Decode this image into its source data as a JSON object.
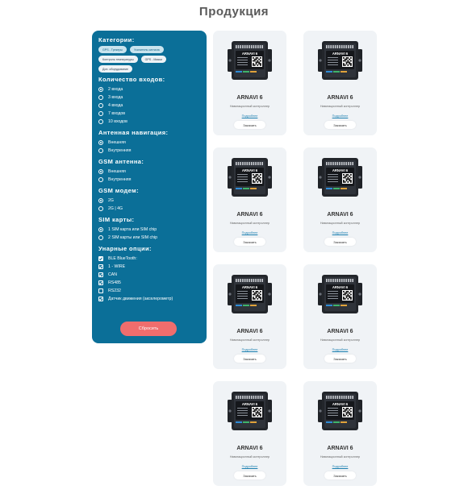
{
  "page": {
    "title": "Продукция"
  },
  "filters": {
    "categories_title": "Категории:",
    "categories": [
      {
        "label": "GPS - Трекеры",
        "active": true
      },
      {
        "label": "Усилитель сигнала",
        "active": false
      },
      {
        "label": "Контроль температуры",
        "active": false
      },
      {
        "label": "GPS - Маяки",
        "active": false
      },
      {
        "label": "Доп. оборудование",
        "active": false
      }
    ],
    "inputs_title": "Количество входов:",
    "inputs": [
      "2 входа",
      "3 входа",
      "4 входа",
      "7 входов",
      "10 входов"
    ],
    "antenna_title": "Антенная навигация:",
    "antenna": [
      "Внешняя",
      "Внутренняя"
    ],
    "gsm_antenna_title": "GSM антенна:",
    "gsm_antenna": [
      "Внешняя",
      "Внутренняя"
    ],
    "gsm_modem_title": "GSM модем:",
    "gsm_modem": [
      "2G",
      "2G | 4G"
    ],
    "sim_title": "SIM карты:",
    "sim": [
      "1 SIM карта или SIM chip",
      "2 SIM карты или SIM chip"
    ],
    "options_title": "Унарные опции:",
    "options": [
      "BLE BlueTooth:",
      "1 - WIRE",
      "CAN",
      "RS485",
      "RS232",
      "Датчик движения (акселерометр)"
    ],
    "reset_label": "Сбросить"
  },
  "products": [
    {
      "name": "ARNAVI 6",
      "subtitle": "Навигационный контроллер",
      "link": "Подробнее",
      "button": "Заказать"
    },
    {
      "name": "ARNAVI 6",
      "subtitle": "Навигационный контроллер",
      "link": "Подробнее",
      "button": "Заказать"
    },
    {
      "name": "ARNAVI 6",
      "subtitle": "Навигационный контроллер",
      "link": "Подробнее",
      "button": "Заказать"
    },
    {
      "name": "ARNAVI 6",
      "subtitle": "Навигационный контроллер",
      "link": "Подробнее",
      "button": "Заказать"
    },
    {
      "name": "ARNAVI 6",
      "subtitle": "Навигационный контроллер",
      "link": "Подробнее",
      "button": "Заказать"
    },
    {
      "name": "ARNAVI 6",
      "subtitle": "Навигационный контроллер",
      "link": "Подробнее",
      "button": "Заказать"
    },
    {
      "name": "ARNAVI 6",
      "subtitle": "Навигационный контроллер",
      "link": "Подробнее",
      "button": "Заказать"
    },
    {
      "name": "ARNAVI 6",
      "subtitle": "Навигационный контроллер",
      "link": "Подробнее",
      "button": "Заказать"
    }
  ],
  "device_label": "ARNAVI 6",
  "colors": {
    "sidebar": "#0b6f98",
    "reset": "#f06d6d",
    "card": "#f0f3f6",
    "link": "#1b7fb0"
  }
}
